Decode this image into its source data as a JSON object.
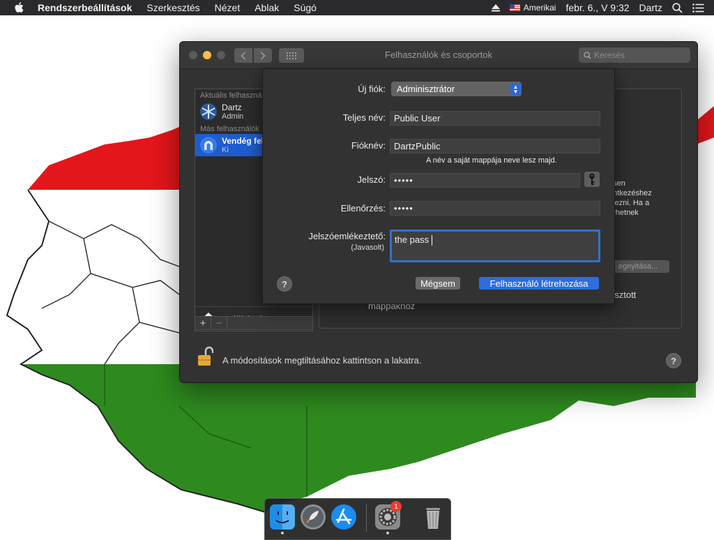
{
  "menubar": {
    "app_name": "Rendszerbeállítások",
    "items": [
      "Szerkesztés",
      "Nézet",
      "Ablak",
      "Súgó"
    ],
    "keyboard_layout": "Amerikai",
    "datetime": "febr. 6., V  9:32",
    "user": "Dartz",
    "icons": [
      "apple-icon",
      "eject-icon",
      "us-flag-icon",
      "spotlight-search-icon",
      "notification-center-icon"
    ]
  },
  "window": {
    "title": "Felhasználók és csoportok",
    "search_placeholder": "Keresés",
    "sidebar": {
      "current_section": "Aktuális felhasználó",
      "other_section": "Más felhasználók",
      "users": [
        {
          "name": "Dartz",
          "role": "Admin"
        },
        {
          "name": "Vendég felhasználó",
          "role": "Ki"
        }
      ],
      "settings_label": "Beállítások"
    },
    "right_panel": {
      "text_lines": [
        "esen",
        "entkezéshez",
        "tkezni. Ha a",
        "érhetnek"
      ],
      "login_options_btn": "egnyitása...",
      "shared_1": "osztott",
      "shared_2": "mappákhoz"
    },
    "lock_text": "A módosítások megtiltásához kattintson a lakatra.",
    "help": "?"
  },
  "sheet": {
    "new_account_label": "Új fiók:",
    "new_account_value": "Adminisztrátor",
    "full_name_label": "Teljes név:",
    "full_name_value": "Public User",
    "account_name_label": "Fióknév:",
    "account_name_value": "DartzPublic",
    "account_name_hint": "A név a saját mappája neve lesz majd.",
    "password_label": "Jelszó:",
    "password_value": "•••••",
    "verify_label": "Ellenőrzés:",
    "verify_value": "•••••",
    "hint_label": "Jelszóemlékeztető:",
    "hint_sublabel": "(Javasolt)",
    "hint_value": "the pass",
    "cancel_label": "Mégsem",
    "create_label": "Felhasználó létrehozása",
    "help": "?"
  },
  "dock": {
    "apps": [
      "Finder",
      "Launchpad",
      "App Store",
      "Rendszerbeállítások",
      "Kuka"
    ],
    "badge_count": "1"
  }
}
